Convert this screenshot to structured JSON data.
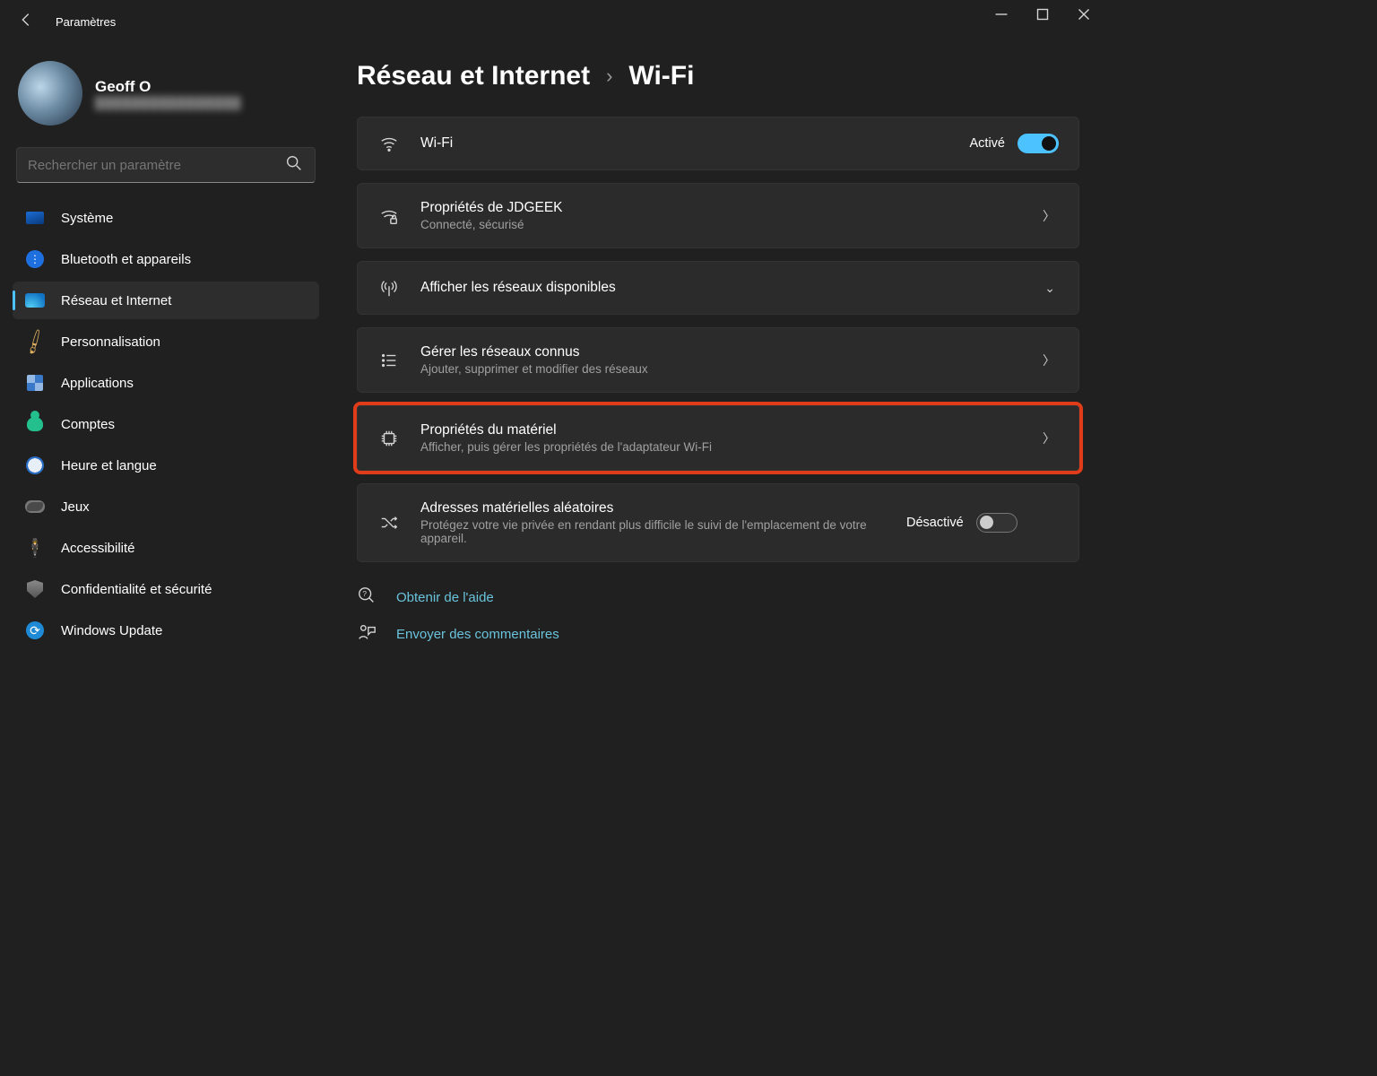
{
  "window": {
    "title": "Paramètres"
  },
  "user": {
    "name": "Geoff O",
    "email": "████████████████"
  },
  "search": {
    "placeholder": "Rechercher un paramètre"
  },
  "nav": {
    "items": [
      {
        "label": "Système"
      },
      {
        "label": "Bluetooth et appareils"
      },
      {
        "label": "Réseau et Internet"
      },
      {
        "label": "Personnalisation"
      },
      {
        "label": "Applications"
      },
      {
        "label": "Comptes"
      },
      {
        "label": "Heure et langue"
      },
      {
        "label": "Jeux"
      },
      {
        "label": "Accessibilité"
      },
      {
        "label": "Confidentialité et sécurité"
      },
      {
        "label": "Windows Update"
      }
    ],
    "selected_index": 2
  },
  "breadcrumb": {
    "parent": "Réseau et Internet",
    "current": "Wi-Fi"
  },
  "cards": {
    "wifi": {
      "title": "Wi-Fi",
      "state_label": "Activé",
      "state": "on"
    },
    "properties": {
      "title": "Propriétés de JDGEEK",
      "sub": "Connecté, sécurisé"
    },
    "show": {
      "title": "Afficher les réseaux disponibles"
    },
    "known": {
      "title": "Gérer les réseaux connus",
      "sub": "Ajouter, supprimer et modifier des réseaux"
    },
    "hardware": {
      "title": "Propriétés du matériel",
      "sub": "Afficher, puis gérer les propriétés de l'adaptateur Wi-Fi"
    },
    "randmac": {
      "title": "Adresses matérielles aléatoires",
      "sub": "Protégez votre vie privée en rendant plus difficile le suivi de l'emplacement de votre appareil.",
      "state_label": "Désactivé",
      "state": "off"
    }
  },
  "help": {
    "get": "Obtenir de l'aide",
    "feedback": "Envoyer des commentaires"
  }
}
